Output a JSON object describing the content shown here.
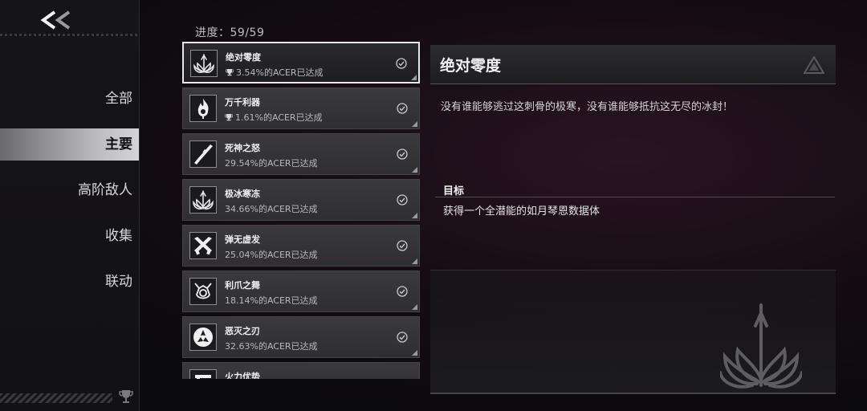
{
  "header": {
    "back_icon": "double-chevron-left-icon"
  },
  "sidebar": {
    "items": [
      {
        "label": "全部",
        "active": false
      },
      {
        "label": "主要",
        "active": true
      },
      {
        "label": "高阶敌人",
        "active": false
      },
      {
        "label": "收集",
        "active": false
      },
      {
        "label": "联动",
        "active": false
      }
    ],
    "footer_icon": "trophy-icon"
  },
  "progress": {
    "text": "进度：59/59"
  },
  "achievements": [
    {
      "name": "绝对零度",
      "percent": "3.54%的ACER已达成",
      "rare": true,
      "completed": true,
      "selected": true,
      "icon": "ice-flower-icon"
    },
    {
      "name": "万千利器",
      "percent": "1.61%的ACER已达成",
      "rare": true,
      "completed": true,
      "selected": false,
      "icon": "flame-icon"
    },
    {
      "name": "死神之怒",
      "percent": "29.54%的ACER已达成",
      "rare": false,
      "completed": true,
      "selected": false,
      "icon": "blade-icon"
    },
    {
      "name": "极冰寒冻",
      "percent": "34.66%的ACER已达成",
      "rare": false,
      "completed": true,
      "selected": false,
      "icon": "ice-flower-icon"
    },
    {
      "name": "弹无虚发",
      "percent": "25.04%的ACER已达成",
      "rare": false,
      "completed": true,
      "selected": false,
      "icon": "crossed-guns-icon"
    },
    {
      "name": "利爪之舞",
      "percent": "18.14%的ACER已达成",
      "rare": false,
      "completed": true,
      "selected": false,
      "icon": "claw-icon"
    },
    {
      "name": "恶灭之刃",
      "percent": "32.63%的ACER已达成",
      "rare": false,
      "completed": true,
      "selected": false,
      "icon": "triskelion-icon"
    },
    {
      "name": "火力优势",
      "percent": "",
      "rare": false,
      "completed": false,
      "selected": false,
      "icon": "gun-icon"
    }
  ],
  "detail": {
    "title": "绝对零度",
    "description": "没有谁能够逃过这刺骨的极寒，没有谁能够抵抗这无尽的冰封！",
    "goal_label": "目标",
    "goal_text": "获得一个全潜能的如月琴恩数据体",
    "emblem_icon": "ice-flower-emblem-icon"
  }
}
